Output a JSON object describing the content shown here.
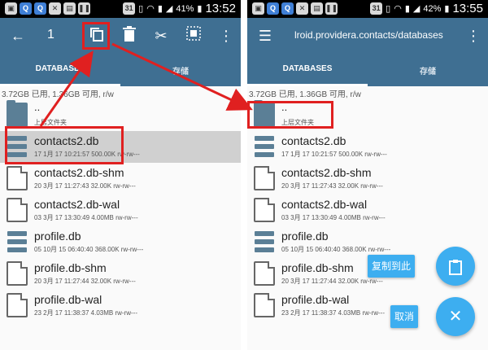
{
  "status_bar": {
    "left": {
      "notif1": "31",
      "battery": "41%",
      "time": "13:52"
    },
    "right": {
      "notif1": "31",
      "battery": "42%",
      "time": "13:55"
    }
  },
  "left_toolbar": {
    "selected_count": "1"
  },
  "right_toolbar": {
    "path": "lroid.providera.contacts/databases"
  },
  "tabs": {
    "databases": "DATABASES",
    "storage": "存储"
  },
  "storage_info": "3.72GB 已用, 1.36GB 可用, r/w",
  "parent": {
    "name": "..",
    "label": "上层文件夹"
  },
  "files": [
    {
      "name": "contacts2.db",
      "meta": "17 1月 17 10:21:57  500.00K  rw-rw---",
      "type": "db"
    },
    {
      "name": "contacts2.db-shm",
      "meta": "20 3月 17 11:27:43  32.00K  rw-rw---",
      "type": "doc"
    },
    {
      "name": "contacts2.db-wal",
      "meta": "03 3月 17 13:30:49  4.00MB  rw-rw---",
      "type": "doc"
    },
    {
      "name": "profile.db",
      "meta": "05 10月 15 06:40:40  368.00K  rw-rw---",
      "type": "db"
    },
    {
      "name": "profile.db-shm",
      "meta": "20 3月 17 11:27:44  32.00K  rw-rw---",
      "type": "doc"
    },
    {
      "name": "profile.db-wal",
      "meta": "23 2月 17 11:38:37  4.03MB  rw-rw---",
      "type": "doc"
    }
  ],
  "fab": {
    "paste_label": "复制到此",
    "cancel_label": "取消"
  },
  "colors": {
    "toolbar": "#3f6f92",
    "accent": "#3daef0",
    "annotation": "#e02020"
  },
  "icons": [
    "back-arrow-icon",
    "copy-icon",
    "delete-icon",
    "cut-icon",
    "select-all-icon",
    "overflow-menu-icon",
    "hamburger-menu-icon",
    "folder-icon",
    "database-icon",
    "document-icon",
    "clipboard-icon",
    "close-icon"
  ]
}
